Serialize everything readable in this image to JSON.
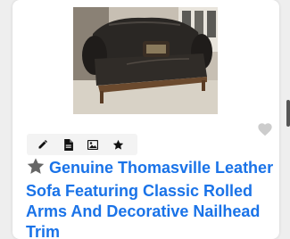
{
  "listing": {
    "title": "Genuine Thomasville Leather Sofa Featuring Classic Rolled Arms And Decorative Nailhead Trim"
  },
  "icons": {
    "favorite": "heart-icon",
    "edit": "pencil-icon",
    "details": "document-icon",
    "gallery": "image-icon",
    "featured": "star-icon",
    "title_badge": "star-icon"
  },
  "colors": {
    "title": "#1a73e8",
    "toolbar_bg": "#f3f3f3",
    "heart": "#cccccc",
    "icon": "#111111"
  }
}
